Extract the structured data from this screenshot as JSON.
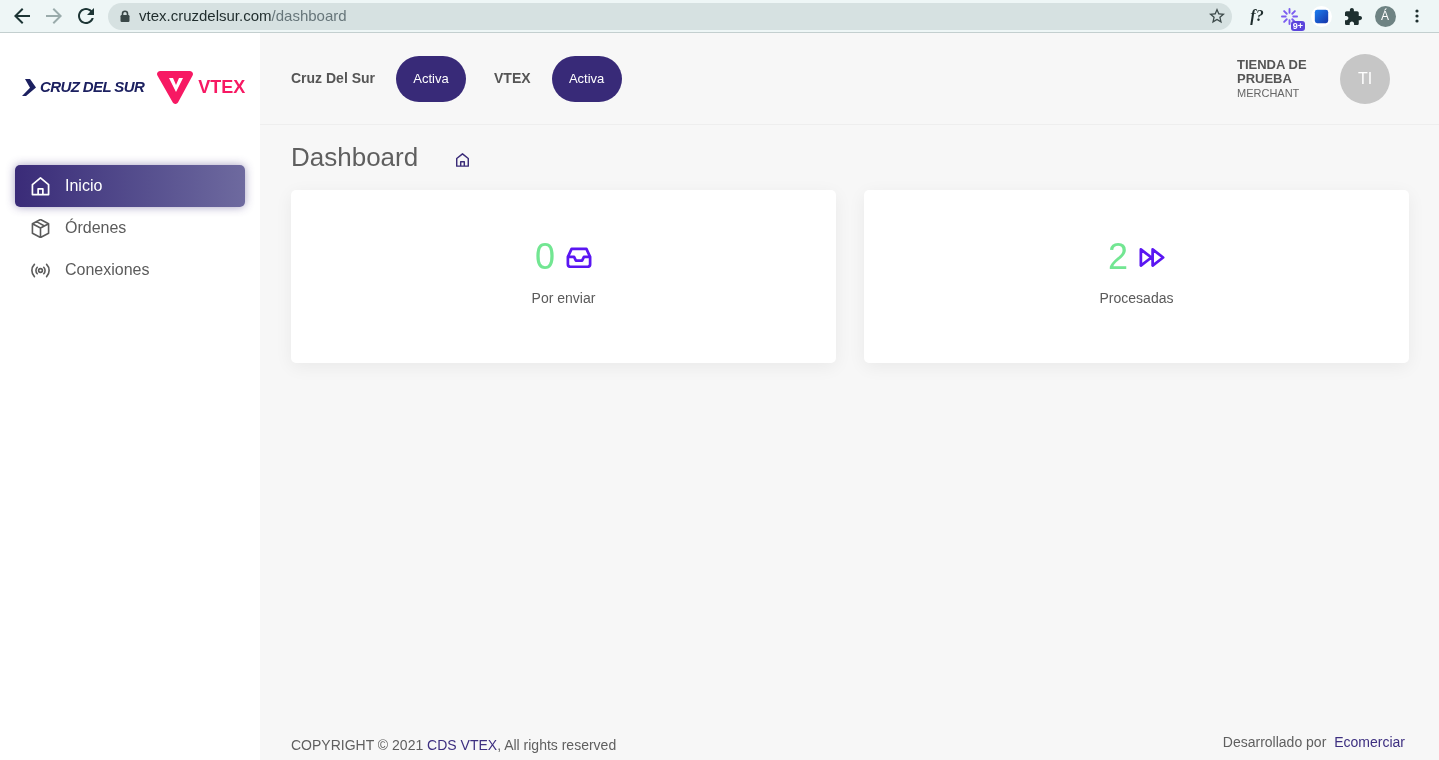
{
  "browser": {
    "nav_buttons": [
      {
        "kind": "back",
        "disabled": false
      },
      {
        "kind": "forward",
        "disabled": true
      },
      {
        "kind": "reload",
        "disabled": false
      }
    ],
    "address": {
      "host": "vtex.cruzdelsur.com",
      "path": "/dashboard"
    },
    "extensions": [
      {
        "kind": "text",
        "label": "f?"
      },
      {
        "kind": "sparkle",
        "badge": "9+"
      },
      {
        "kind": "tile"
      },
      {
        "kind": "puzzle"
      }
    ],
    "profile_initial": "Á"
  },
  "sidebar": {
    "logos": [
      {
        "kind": "cruz-del-sur",
        "text": "CRUZ DEL SUR"
      },
      {
        "kind": "vtex",
        "text": "VTEX"
      }
    ],
    "items": [
      {
        "kind": "home",
        "label": "Inicio",
        "selected": true
      },
      {
        "kind": "box",
        "label": "Órdenes",
        "selected": false
      },
      {
        "kind": "broadcast",
        "label": "Conexiones",
        "selected": false
      }
    ]
  },
  "header": {
    "connections": [
      {
        "name": "Cruz Del Sur",
        "status": "Activa"
      },
      {
        "name": "VTEX",
        "status": "Activa"
      }
    ],
    "user": {
      "name": "TIENDA DE PRUEBA",
      "role": "MERCHANT",
      "initials": "TI"
    }
  },
  "page": {
    "title": "Dashboard"
  },
  "cards": [
    {
      "kind": "inbox",
      "value": "0",
      "label": "Por enviar"
    },
    {
      "kind": "forward",
      "value": "2",
      "label": "Procesadas"
    }
  ],
  "footer": {
    "copyright": {
      "before": "COPYRIGHT © 2021",
      "link": "CDS VTEX",
      "after": ", All rights reserved"
    },
    "credit": {
      "text": "Desarrollado por",
      "link": "Ecomerciar"
    }
  }
}
